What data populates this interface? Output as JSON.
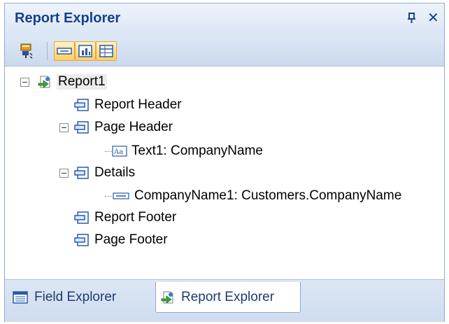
{
  "panel": {
    "title": "Report Explorer",
    "pin_icon": "pin-icon",
    "close_label": "✕"
  },
  "toolbar": {
    "buttons": [
      {
        "name": "remove-control-icon",
        "active": false
      },
      {
        "name": "show-controls-icon",
        "active": true
      },
      {
        "name": "show-fields-icon",
        "active": true
      },
      {
        "name": "show-tables-icon",
        "active": true
      }
    ]
  },
  "tree": {
    "report": "Report1",
    "report_header": "Report Header",
    "page_header": "Page Header",
    "text1": "Text1: CompanyName",
    "details": "Details",
    "company_name1": "CompanyName1: Customers.CompanyName",
    "report_footer": "Report Footer",
    "page_footer": "Page Footer"
  },
  "tabs": [
    {
      "label": "Field Explorer",
      "active": false
    },
    {
      "label": "Report Explorer",
      "active": true
    }
  ],
  "colors": {
    "title": "#15428b",
    "active_button": "#ffcf60",
    "border": "#8eaad6"
  }
}
